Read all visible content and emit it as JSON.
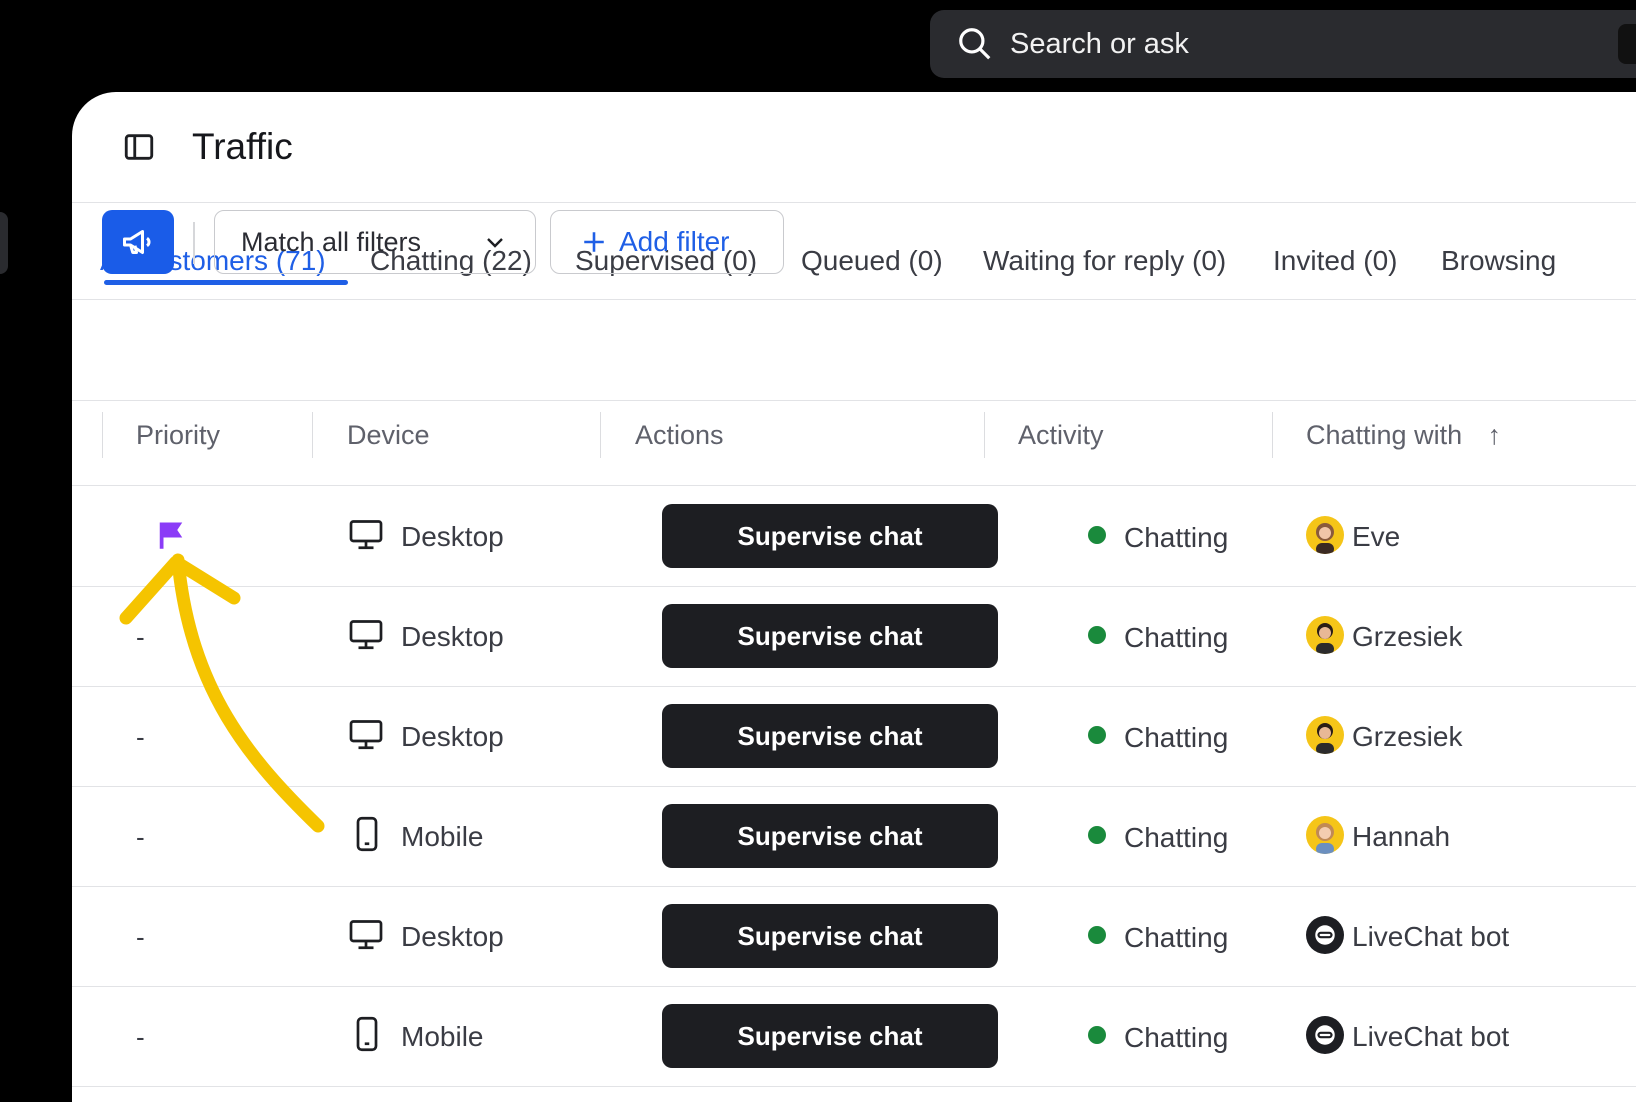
{
  "search": {
    "placeholder": "Search or ask"
  },
  "header": {
    "title": "Traffic"
  },
  "tabs": [
    {
      "label": "All customers (71)",
      "active": true
    },
    {
      "label": "Chatting (22)"
    },
    {
      "label": "Supervised (0)"
    },
    {
      "label": "Queued (0)"
    },
    {
      "label": "Waiting for reply (0)"
    },
    {
      "label": "Invited (0)"
    },
    {
      "label": "Browsing"
    }
  ],
  "toolbar": {
    "match_label": "Match all filters",
    "add_filter_label": "Add filter"
  },
  "table": {
    "columns": [
      "Priority",
      "Device",
      "Actions",
      "Activity",
      "Chatting with"
    ],
    "sort_indicator": "↑",
    "rows": [
      {
        "priority": "",
        "priority_flag": true,
        "device": "Desktop",
        "device_icon": "desktop-icon",
        "action": "Supervise chat",
        "activity": "Chatting",
        "agent": "Eve",
        "agent_type": "person"
      },
      {
        "priority": "-",
        "device": "Desktop",
        "device_icon": "desktop-icon",
        "action": "Supervise chat",
        "activity": "Chatting",
        "agent": "Grzesiek",
        "agent_type": "person"
      },
      {
        "priority": "-",
        "device": "Desktop",
        "device_icon": "desktop-icon",
        "action": "Supervise chat",
        "activity": "Chatting",
        "agent": "Grzesiek",
        "agent_type": "person"
      },
      {
        "priority": "-",
        "device": "Mobile",
        "device_icon": "mobile-icon",
        "action": "Supervise chat",
        "activity": "Chatting",
        "agent": "Hannah",
        "agent_type": "person"
      },
      {
        "priority": "-",
        "device": "Desktop",
        "device_icon": "desktop-icon",
        "action": "Supervise chat",
        "activity": "Chatting",
        "agent": "LiveChat bot",
        "agent_type": "bot"
      },
      {
        "priority": "-",
        "device": "Mobile",
        "device_icon": "mobile-icon",
        "action": "Supervise chat",
        "activity": "Chatting",
        "agent": "LiveChat bot",
        "agent_type": "bot"
      }
    ]
  },
  "colors": {
    "accent": "#1f5fe6",
    "flag": "#8b3cf7",
    "status_green": "#1a8a3c",
    "annotation_arrow": "#f5c400"
  }
}
